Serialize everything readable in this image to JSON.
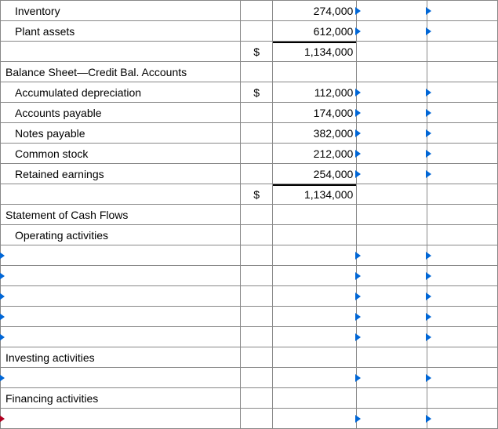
{
  "rows": [
    {
      "label": "Inventory",
      "indent": true,
      "sym": "",
      "val": "274,000",
      "m1": "blue",
      "m2": "blue"
    },
    {
      "label": "Plant assets",
      "indent": true,
      "sym": "",
      "val": "612,000",
      "m1": "blue",
      "m2": "blue"
    },
    {
      "label": "",
      "indent": false,
      "sym": "$",
      "val": "1,134,000",
      "total": true,
      "m1": "",
      "m2": ""
    },
    {
      "label": "Balance Sheet—Credit Bal. Accounts",
      "indent": false,
      "sym": "",
      "val": "",
      "m1": "",
      "m2": ""
    },
    {
      "label": "Accumulated depreciation",
      "indent": true,
      "sym": "$",
      "val": "112,000",
      "m1": "blue",
      "m2": "blue"
    },
    {
      "label": "Accounts payable",
      "indent": true,
      "sym": "",
      "val": "174,000",
      "m1": "blue",
      "m2": "blue"
    },
    {
      "label": "Notes payable",
      "indent": true,
      "sym": "",
      "val": "382,000",
      "m1": "blue",
      "m2": "blue"
    },
    {
      "label": "Common stock",
      "indent": true,
      "sym": "",
      "val": "212,000",
      "m1": "blue",
      "m2": "blue"
    },
    {
      "label": "Retained earnings",
      "indent": true,
      "sym": "",
      "val": "254,000",
      "m1": "blue",
      "m2": "blue"
    },
    {
      "label": "",
      "indent": false,
      "sym": "$",
      "val": "1,134,000",
      "total": true,
      "m1": "",
      "m2": ""
    },
    {
      "label": "Statement of Cash Flows",
      "indent": false,
      "sym": "",
      "val": "",
      "m1": "",
      "m2": ""
    },
    {
      "label": "Operating activities",
      "indent": true,
      "sym": "",
      "val": "",
      "m1": "",
      "m2": ""
    },
    {
      "label": "",
      "indent": false,
      "labelMarker": "blue",
      "sym": "",
      "val": "",
      "m1": "blue",
      "m2": "blue"
    },
    {
      "label": "",
      "indent": false,
      "labelMarker": "blue",
      "sym": "",
      "val": "",
      "m1": "blue",
      "m2": "blue"
    },
    {
      "label": "",
      "indent": false,
      "labelMarker": "blue",
      "sym": "",
      "val": "",
      "m1": "blue",
      "m2": "blue"
    },
    {
      "label": "",
      "indent": false,
      "labelMarker": "blue",
      "sym": "",
      "val": "",
      "m1": "blue",
      "m2": "blue"
    },
    {
      "label": "",
      "indent": false,
      "labelMarker": "blue",
      "sym": "",
      "val": "",
      "m1": "blue",
      "m2": "blue"
    },
    {
      "label": "Investing activities",
      "indent": false,
      "sym": "",
      "val": "",
      "m1": "",
      "m2": ""
    },
    {
      "label": "",
      "indent": false,
      "labelMarker": "blue",
      "sym": "",
      "val": "",
      "m1": "blue",
      "m2": "blue"
    },
    {
      "label": "Financing activities",
      "indent": false,
      "sym": "",
      "val": "",
      "m1": "",
      "m2": ""
    },
    {
      "label": "",
      "indent": false,
      "labelMarker": "red",
      "sym": "",
      "val": "",
      "m1": "blue",
      "m2": "blue"
    }
  ]
}
